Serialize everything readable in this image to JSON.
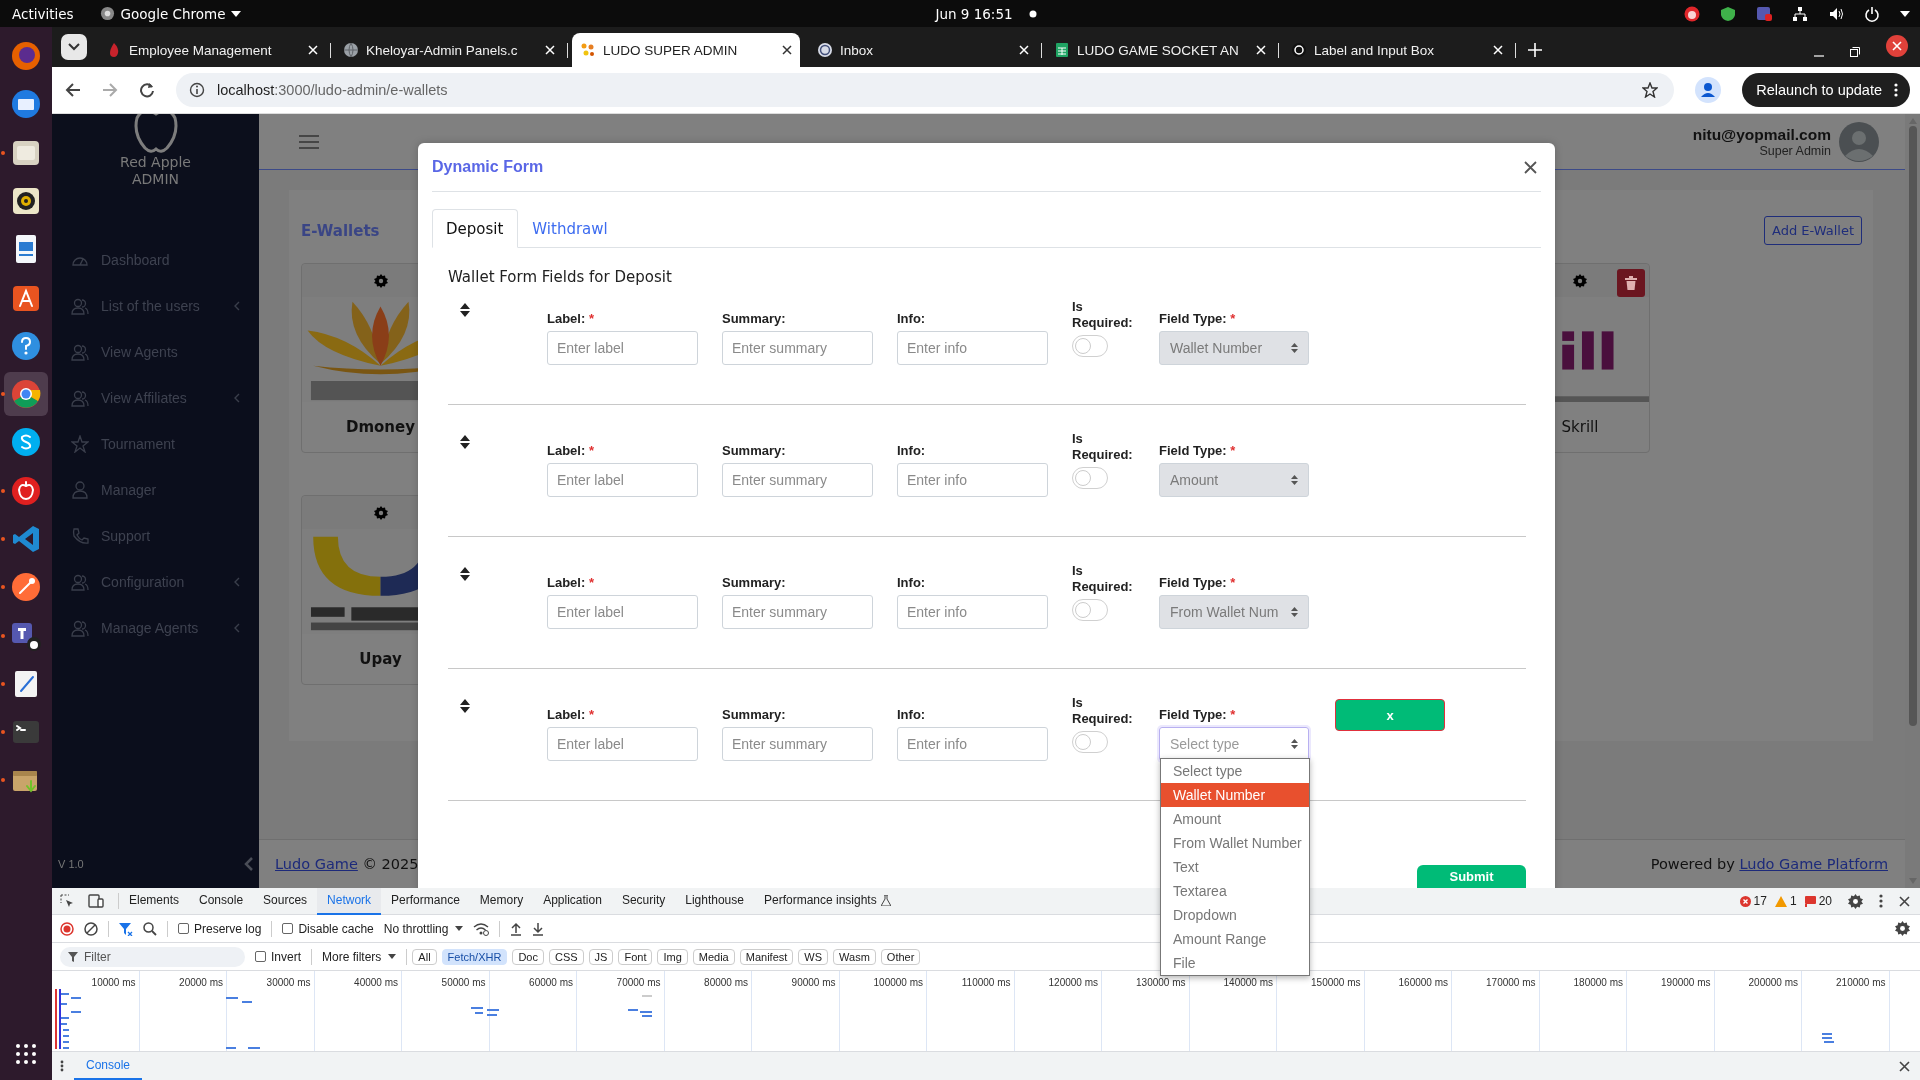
{
  "topbar": {
    "activities": "Activities",
    "app_menu": "Google Chrome",
    "clock": "Jun 9  16:51"
  },
  "dock": [
    {
      "running": false,
      "selected": false
    },
    {
      "running": false,
      "selected": false
    },
    {
      "running": true,
      "selected": false
    },
    {
      "running": false,
      "selected": false
    },
    {
      "running": false,
      "selected": false
    },
    {
      "running": false,
      "selected": false
    },
    {
      "running": false,
      "selected": false
    },
    {
      "running": true,
      "selected": true
    },
    {
      "running": false,
      "selected": false
    },
    {
      "running": true,
      "selected": false
    },
    {
      "running": true,
      "selected": false
    },
    {
      "running": true,
      "selected": false
    },
    {
      "running": true,
      "selected": false
    },
    {
      "running": true,
      "selected": false
    },
    {
      "running": true,
      "selected": false
    },
    {
      "running": true,
      "selected": false
    }
  ],
  "browser": {
    "tabs": [
      {
        "title": "Employee Management",
        "selected": false
      },
      {
        "title": "Kheloyar-Admin Panels.c",
        "selected": false
      },
      {
        "title": "LUDO SUPER ADMIN",
        "selected": true
      },
      {
        "title": "Inbox",
        "selected": false
      },
      {
        "title": "LUDO GAME SOCKET AN",
        "selected": false
      },
      {
        "title": "Label and Input Box",
        "selected": false
      }
    ],
    "url_host": "localhost",
    "url_path": ":3000/ludo-admin/e-wallets",
    "relaunch": "Relaunch to update"
  },
  "sidebar": {
    "brand": "Red Apple",
    "brand_sub": "ADMIN",
    "items": [
      {
        "label": "Dashboard",
        "expandable": false
      },
      {
        "label": "List of the users",
        "expandable": true
      },
      {
        "label": "View Agents",
        "expandable": false
      },
      {
        "label": "View Affiliates",
        "expandable": true
      },
      {
        "label": "Tournament",
        "expandable": false
      },
      {
        "label": "Manager",
        "expandable": false
      },
      {
        "label": "Support",
        "expandable": false
      },
      {
        "label": "Configuration",
        "expandable": true
      },
      {
        "label": "Manage Agents",
        "expandable": true
      }
    ],
    "version": "V 1.0"
  },
  "header": {
    "email": "nitu@yopmail.com",
    "role": "Super Admin"
  },
  "page": {
    "title": "E-Wallets",
    "add_button": "Add E-Wallet",
    "wallet_rows": [
      [
        {
          "name": "Dmoney",
          "kind": "lotus"
        },
        {
          "name": "Skrill",
          "kind": "wordmark",
          "delete": true
        }
      ],
      [
        {
          "name": "Upay",
          "kind": "arc"
        }
      ]
    ]
  },
  "footer": {
    "link": "Ludo Game",
    "copyright": "© 2025",
    "powered_by": "Powered by",
    "platform_link": "Ludo Game Platform"
  },
  "modal": {
    "title": "Dynamic Form",
    "tabs": [
      {
        "label": "Deposit",
        "selected": true
      },
      {
        "label": "Withdrawl",
        "selected": false
      }
    ],
    "heading": "Wallet Form Fields for Deposit",
    "rows": [
      {
        "label_heading": "Label:",
        "label_mark": "*",
        "label_placeholder": "Enter label",
        "summary_heading": "Summary:",
        "summary_placeholder": "Enter summary",
        "info_heading": "Info:",
        "info_placeholder": "Enter info",
        "required_heading": "Is Required:",
        "required": false,
        "type_heading": "Field Type:",
        "type_mark": "*",
        "type_value": "Wallet Number",
        "disabled": true,
        "focused": false
      },
      {
        "label_heading": "Label:",
        "label_mark": "*",
        "label_placeholder": "Enter label",
        "summary_heading": "Summary:",
        "summary_placeholder": "Enter summary",
        "info_heading": "Info:",
        "info_placeholder": "Enter info",
        "required_heading": "Is Required:",
        "required": false,
        "type_heading": "Field Type:",
        "type_mark": "*",
        "type_value": "Amount",
        "disabled": true,
        "focused": false
      },
      {
        "label_heading": "Label:",
        "label_mark": "*",
        "label_placeholder": "Enter label",
        "summary_heading": "Summary:",
        "summary_placeholder": "Enter summary",
        "info_heading": "Info:",
        "info_placeholder": "Enter info",
        "required_heading": "Is Required:",
        "required": false,
        "type_heading": "Field Type:",
        "type_mark": "*",
        "type_value": "From Wallet Num",
        "disabled": true,
        "focused": false
      },
      {
        "label_heading": "Label:",
        "label_mark": "*",
        "label_placeholder": "Enter label",
        "summary_heading": "Summary:",
        "summary_placeholder": "Enter summary",
        "info_heading": "Info:",
        "info_placeholder": "Enter info",
        "required_heading": "Is Required:",
        "required": false,
        "type_heading": "Field Type:",
        "type_mark": "*",
        "type_placeholder": "Select type",
        "disabled": false,
        "focused": true,
        "remove": "x"
      }
    ],
    "submit": "Submit"
  },
  "dropdown": {
    "options": [
      {
        "label": "Select type",
        "selected": false
      },
      {
        "label": "Wallet Number",
        "selected": true
      },
      {
        "label": "Amount",
        "selected": false
      },
      {
        "label": "From Wallet Number",
        "selected": false
      },
      {
        "label": "Text",
        "selected": false
      },
      {
        "label": "Textarea",
        "selected": false
      },
      {
        "label": "Dropdown",
        "selected": false
      },
      {
        "label": "Amount Range",
        "selected": false
      },
      {
        "label": "File",
        "selected": false
      }
    ]
  },
  "devtools": {
    "tabs": [
      {
        "label": "Elements",
        "selected": false
      },
      {
        "label": "Console",
        "selected": false
      },
      {
        "label": "Sources",
        "selected": false
      },
      {
        "label": "Network",
        "selected": true
      },
      {
        "label": "Performance",
        "selected": false
      },
      {
        "label": "Memory",
        "selected": false
      },
      {
        "label": "Application",
        "selected": false
      },
      {
        "label": "Security",
        "selected": false
      },
      {
        "label": "Lighthouse",
        "selected": false
      },
      {
        "label": "Performance insights",
        "selected": false
      }
    ],
    "errors": "17",
    "warnings": "1",
    "issues": "20",
    "preserve_log": {
      "label": "Preserve log",
      "checked": false
    },
    "disable_cache": {
      "label": "Disable cache",
      "checked": false
    },
    "throttling": "No throttling",
    "filter_placeholder": "Filter",
    "invert": {
      "label": "Invert",
      "checked": false
    },
    "more_filters": "More filters",
    "type_filters": [
      {
        "label": "All",
        "selected": false
      },
      {
        "label": "Fetch/XHR",
        "selected": true
      },
      {
        "label": "Doc",
        "selected": false
      },
      {
        "label": "CSS",
        "selected": false
      },
      {
        "label": "JS",
        "selected": false
      },
      {
        "label": "Font",
        "selected": false
      },
      {
        "label": "Img",
        "selected": false
      },
      {
        "label": "Media",
        "selected": false
      },
      {
        "label": "Manifest",
        "selected": false
      },
      {
        "label": "WS",
        "selected": false
      },
      {
        "label": "Wasm",
        "selected": false
      },
      {
        "label": "Other",
        "selected": false
      }
    ],
    "timeline_ticks": [
      "10000 ms",
      "20000 ms",
      "30000 ms",
      "40000 ms",
      "50000 ms",
      "60000 ms",
      "70000 ms",
      "80000 ms",
      "90000 ms",
      "100000 ms",
      "110000 ms",
      "120000 ms",
      "130000 ms",
      "140000 ms",
      "150000 ms",
      "160000 ms",
      "170000 ms",
      "180000 ms",
      "190000 ms",
      "200000 ms",
      "210000 ms"
    ],
    "drawer_tabs": [
      {
        "label": "Console",
        "selected": true
      }
    ]
  }
}
